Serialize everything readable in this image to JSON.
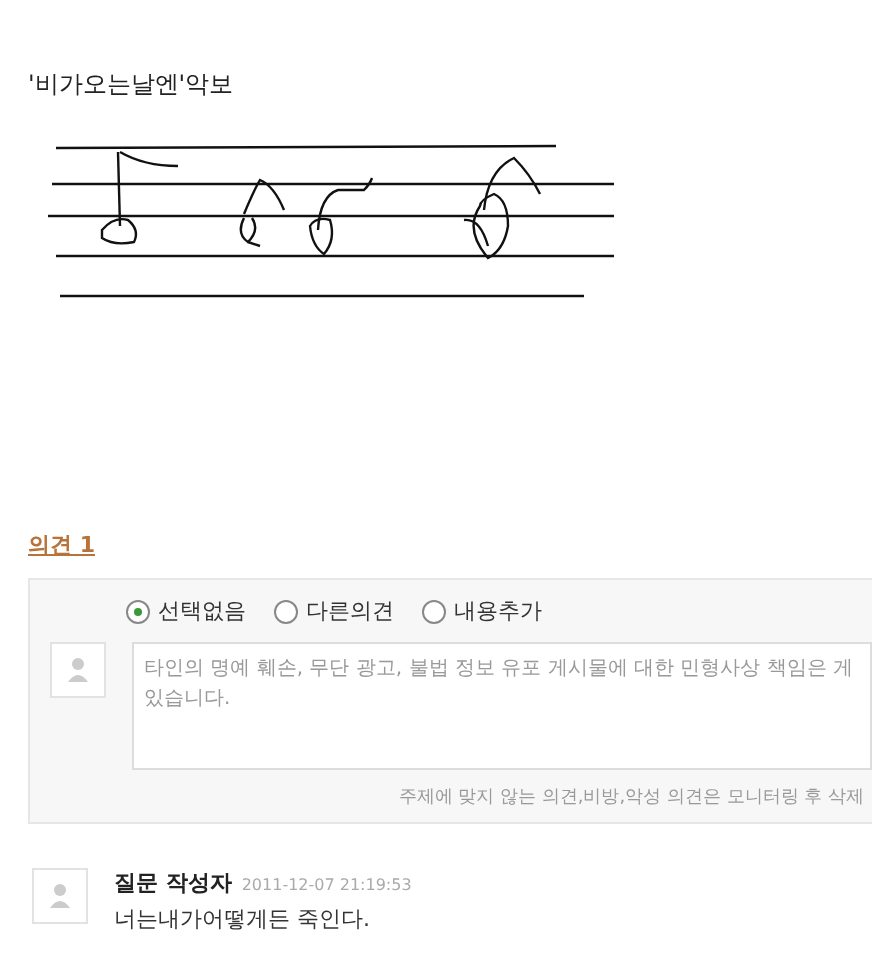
{
  "post": {
    "title": "'비가오는날엔'악보"
  },
  "opinions": {
    "heading": "의견 1",
    "options": [
      {
        "label": "선택없음",
        "selected": true
      },
      {
        "label": "다른의견",
        "selected": false
      },
      {
        "label": "내용추가",
        "selected": false
      }
    ],
    "input": {
      "placeholder": "타인의 명예 훼손, 무단 광고, 불법 정보 유포 게시물에 대한 민형사상 책임은 게 있습니다."
    },
    "notice": "주제에 맞지 않는 의견,비방,악성 의견은 모니터링 후 삭제"
  },
  "comments": [
    {
      "author": "질문 작성자",
      "date": "2011-12-07 21:19:53",
      "text": "너는내가어떻게든 죽인다."
    }
  ]
}
